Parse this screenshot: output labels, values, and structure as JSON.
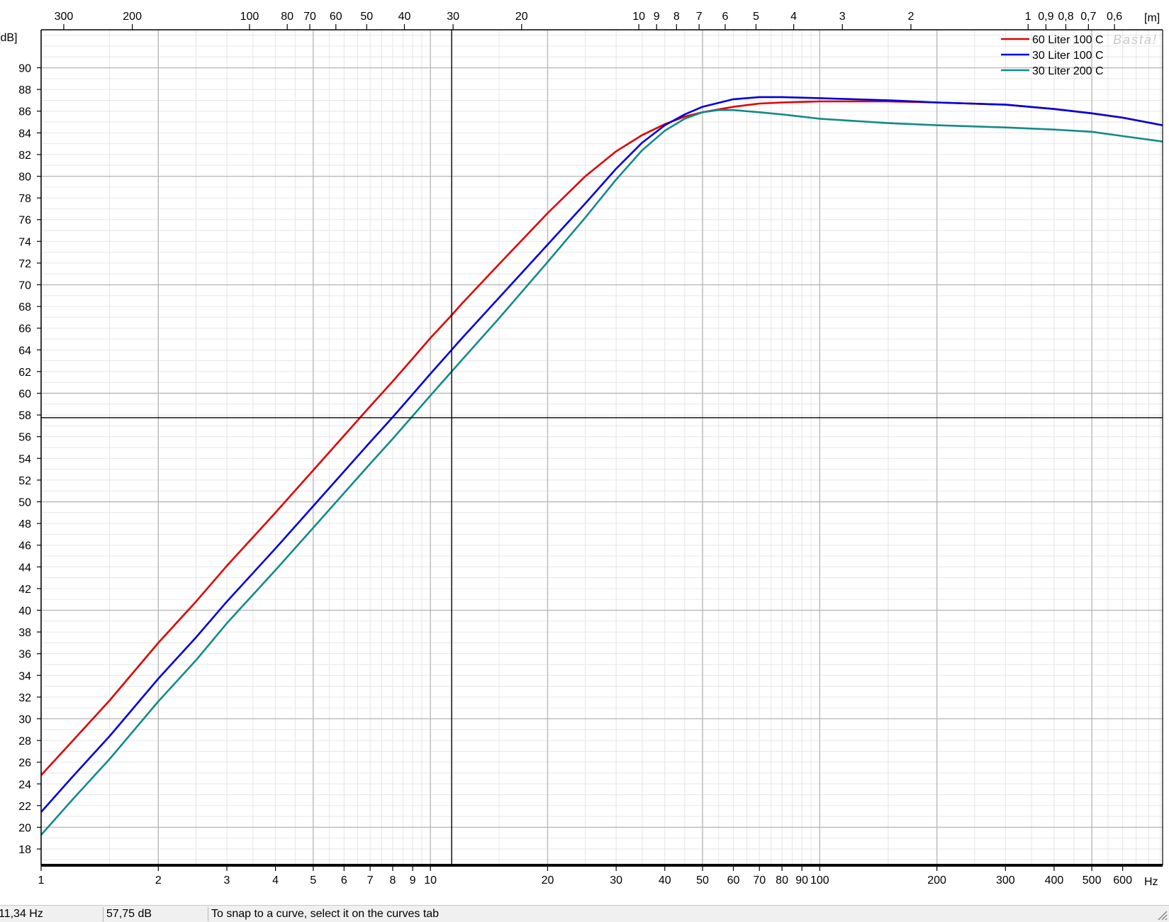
{
  "chart_data": {
    "type": "line",
    "y_unit_label": "[dB]",
    "top_axis_unit": "[m]",
    "bottom_axis_unit": "Hz",
    "x_scale": "log",
    "xlim": [
      1,
      760
    ],
    "ylim": [
      16.5,
      93.5
    ],
    "y_ticks": [
      18,
      20,
      22,
      24,
      26,
      28,
      30,
      32,
      34,
      36,
      38,
      40,
      42,
      44,
      46,
      48,
      50,
      52,
      54,
      56,
      58,
      60,
      62,
      64,
      66,
      68,
      70,
      72,
      74,
      76,
      78,
      80,
      82,
      84,
      86,
      88,
      90
    ],
    "x_tick_labels": [
      {
        "value": 1,
        "label": "1"
      },
      {
        "value": 2,
        "label": "2"
      },
      {
        "value": 3,
        "label": "3"
      },
      {
        "value": 4,
        "label": "4"
      },
      {
        "value": 5,
        "label": "5"
      },
      {
        "value": 6,
        "label": "6"
      },
      {
        "value": 7,
        "label": "7"
      },
      {
        "value": 8,
        "label": "8"
      },
      {
        "value": 9,
        "label": "9"
      },
      {
        "value": 10,
        "label": "10"
      },
      {
        "value": 20,
        "label": "20"
      },
      {
        "value": 30,
        "label": "30"
      },
      {
        "value": 40,
        "label": "40"
      },
      {
        "value": 50,
        "label": "50"
      },
      {
        "value": 60,
        "label": "60"
      },
      {
        "value": 70,
        "label": "70"
      },
      {
        "value": 80,
        "label": "80"
      },
      {
        "value": 90,
        "label": "90"
      },
      {
        "value": 100,
        "label": "100"
      },
      {
        "value": 200,
        "label": "200"
      },
      {
        "value": 300,
        "label": "300"
      },
      {
        "value": 400,
        "label": "400"
      },
      {
        "value": 500,
        "label": "500"
      },
      {
        "value": 600,
        "label": "600"
      }
    ],
    "top_tick_labels": [
      {
        "value": 300,
        "label": "300"
      },
      {
        "value": 200,
        "label": "200"
      },
      {
        "value": 100,
        "label": "100"
      },
      {
        "value": 80,
        "label": "80"
      },
      {
        "value": 70,
        "label": "70"
      },
      {
        "value": 60,
        "label": "60"
      },
      {
        "value": 50,
        "label": "50"
      },
      {
        "value": 40,
        "label": "40"
      },
      {
        "value": 30,
        "label": "30"
      },
      {
        "value": 20,
        "label": "20"
      },
      {
        "value": 10,
        "label": "10"
      },
      {
        "value": 9,
        "label": "9"
      },
      {
        "value": 8,
        "label": "8"
      },
      {
        "value": 7,
        "label": "7"
      },
      {
        "value": 6,
        "label": "6"
      },
      {
        "value": 5,
        "label": "5"
      },
      {
        "value": 4,
        "label": "4"
      },
      {
        "value": 3,
        "label": "3"
      },
      {
        "value": 2,
        "label": "2"
      },
      {
        "value": 1,
        "label": "1"
      },
      {
        "value": 0.9,
        "label": "0,9"
      },
      {
        "value": 0.8,
        "label": "0,8"
      },
      {
        "value": 0.7,
        "label": "0,7"
      },
      {
        "value": 0.6,
        "label": "0,6"
      }
    ],
    "top_axis_scale": "wavelength (343 / f)",
    "grid": true,
    "legend_position": "top-right",
    "watermark": "Basta!",
    "cursor": {
      "x": 11.34,
      "y": 57.75
    },
    "series": [
      {
        "name": "60 Liter  100 C",
        "color": "#e00000",
        "points": [
          [
            1,
            24.8
          ],
          [
            1.2,
            27.9
          ],
          [
            1.5,
            31.7
          ],
          [
            2,
            37
          ],
          [
            2.5,
            40.8
          ],
          [
            3,
            44.1
          ],
          [
            4,
            49
          ],
          [
            5,
            52.9
          ],
          [
            6,
            56.1
          ],
          [
            7,
            58.8
          ],
          [
            8,
            61.1
          ],
          [
            9,
            63.2
          ],
          [
            10,
            65.1
          ],
          [
            11.34,
            67.2
          ],
          [
            12,
            68.2
          ],
          [
            15,
            71.9
          ],
          [
            20,
            76.6
          ],
          [
            25,
            80
          ],
          [
            30,
            82.3
          ],
          [
            35,
            83.8
          ],
          [
            40,
            84.8
          ],
          [
            45,
            85.5
          ],
          [
            50,
            85.9
          ],
          [
            60,
            86.4
          ],
          [
            70,
            86.7
          ],
          [
            80,
            86.8
          ],
          [
            100,
            86.9
          ],
          [
            150,
            86.9
          ],
          [
            200,
            86.8
          ],
          [
            300,
            86.6
          ],
          [
            400,
            86.2
          ],
          [
            500,
            85.8
          ],
          [
            600,
            85.4
          ],
          [
            760,
            84.7
          ]
        ]
      },
      {
        "name": "30 Liter  100 C",
        "color": "#0000dd",
        "points": [
          [
            1,
            21.4
          ],
          [
            1.2,
            24.6
          ],
          [
            1.5,
            28.4
          ],
          [
            2,
            33.7
          ],
          [
            2.5,
            37.5
          ],
          [
            3,
            40.8
          ],
          [
            4,
            45.7
          ],
          [
            5,
            49.6
          ],
          [
            6,
            52.8
          ],
          [
            7,
            55.5
          ],
          [
            8,
            57.8
          ],
          [
            9,
            59.9
          ],
          [
            10,
            61.8
          ],
          [
            11.34,
            64
          ],
          [
            12,
            65
          ],
          [
            15,
            68.8
          ],
          [
            20,
            73.7
          ],
          [
            25,
            77.5
          ],
          [
            30,
            80.7
          ],
          [
            35,
            83.1
          ],
          [
            40,
            84.7
          ],
          [
            45,
            85.7
          ],
          [
            50,
            86.4
          ],
          [
            60,
            87.1
          ],
          [
            70,
            87.3
          ],
          [
            80,
            87.3
          ],
          [
            100,
            87.2
          ],
          [
            150,
            87
          ],
          [
            200,
            86.8
          ],
          [
            300,
            86.6
          ],
          [
            400,
            86.2
          ],
          [
            500,
            85.8
          ],
          [
            600,
            85.4
          ],
          [
            760,
            84.7
          ]
        ]
      },
      {
        "name": "30 Liter  200 C",
        "color": "#138a8a",
        "points": [
          [
            1,
            19.3
          ],
          [
            1.2,
            22.5
          ],
          [
            1.5,
            26.3
          ],
          [
            2,
            31.6
          ],
          [
            2.5,
            35.4
          ],
          [
            3,
            38.8
          ],
          [
            4,
            43.7
          ],
          [
            5,
            47.6
          ],
          [
            6,
            50.8
          ],
          [
            7,
            53.5
          ],
          [
            8,
            55.8
          ],
          [
            9,
            57.9
          ],
          [
            10,
            59.8
          ],
          [
            11.34,
            62
          ],
          [
            12,
            63
          ],
          [
            15,
            66.9
          ],
          [
            20,
            72.1
          ],
          [
            25,
            76.2
          ],
          [
            30,
            79.7
          ],
          [
            35,
            82.4
          ],
          [
            40,
            84.2
          ],
          [
            45,
            85.3
          ],
          [
            50,
            85.9
          ],
          [
            55,
            86.1
          ],
          [
            60,
            86.1
          ],
          [
            70,
            85.9
          ],
          [
            80,
            85.7
          ],
          [
            100,
            85.3
          ],
          [
            150,
            84.9
          ],
          [
            200,
            84.7
          ],
          [
            300,
            84.5
          ],
          [
            400,
            84.3
          ],
          [
            500,
            84.1
          ],
          [
            600,
            83.7
          ],
          [
            760,
            83.2
          ]
        ]
      }
    ]
  },
  "status": {
    "frequency": "11,34 Hz",
    "level": "57,75 dB",
    "hint": "To snap to a curve, select it on the curves tab"
  }
}
